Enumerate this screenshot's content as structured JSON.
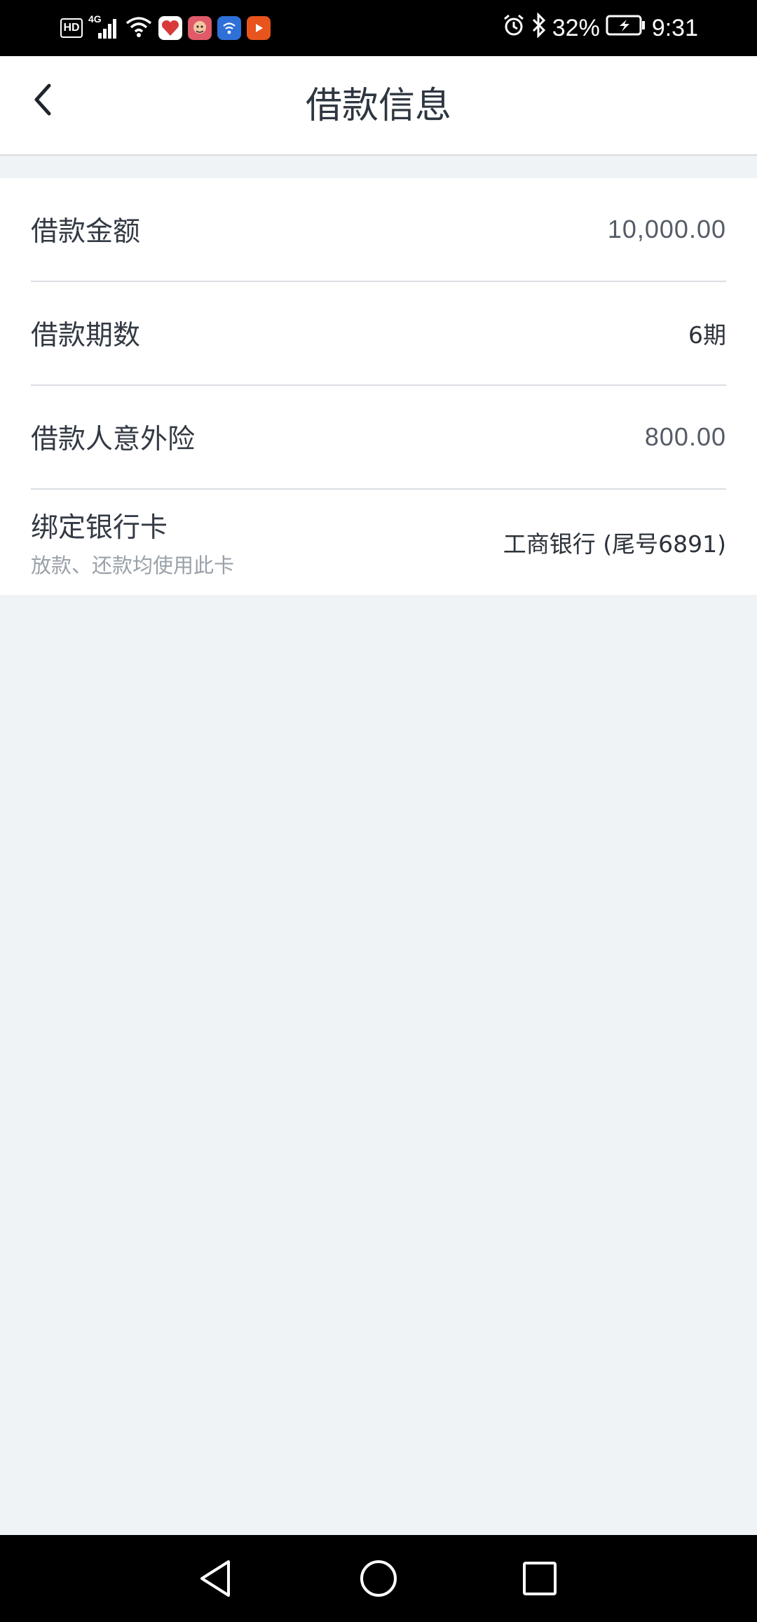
{
  "status_bar": {
    "hd": "HD",
    "network": "4G",
    "battery_percent": "32%",
    "time": "9:31",
    "icons": [
      "signal-icon",
      "wifi-icon",
      "app-icon-heart",
      "app-icon-avatar",
      "app-icon-wifi-service",
      "app-icon-video",
      "alarm-icon",
      "bluetooth-icon",
      "battery-icon"
    ]
  },
  "header": {
    "title": "借款信息",
    "back_icon": "chevron-left-icon"
  },
  "loan_info": {
    "amount": {
      "label": "借款金额",
      "value": "10,000.00"
    },
    "term": {
      "label": "借款期数",
      "value": "6期"
    },
    "insurance": {
      "label": "借款人意外险",
      "value": "800.00"
    },
    "bank_card": {
      "label": "绑定银行卡",
      "sublabel": "放款、还款均使用此卡",
      "value": "工商银行 (尾号6891)"
    }
  },
  "nav_bar": {
    "icons": [
      "back-triangle-icon",
      "home-circle-icon",
      "recents-square-icon"
    ]
  },
  "colors": {
    "background": "#f0f3f6",
    "card": "#ffffff",
    "title_text": "#2e3640",
    "divider": "#dadee2"
  }
}
